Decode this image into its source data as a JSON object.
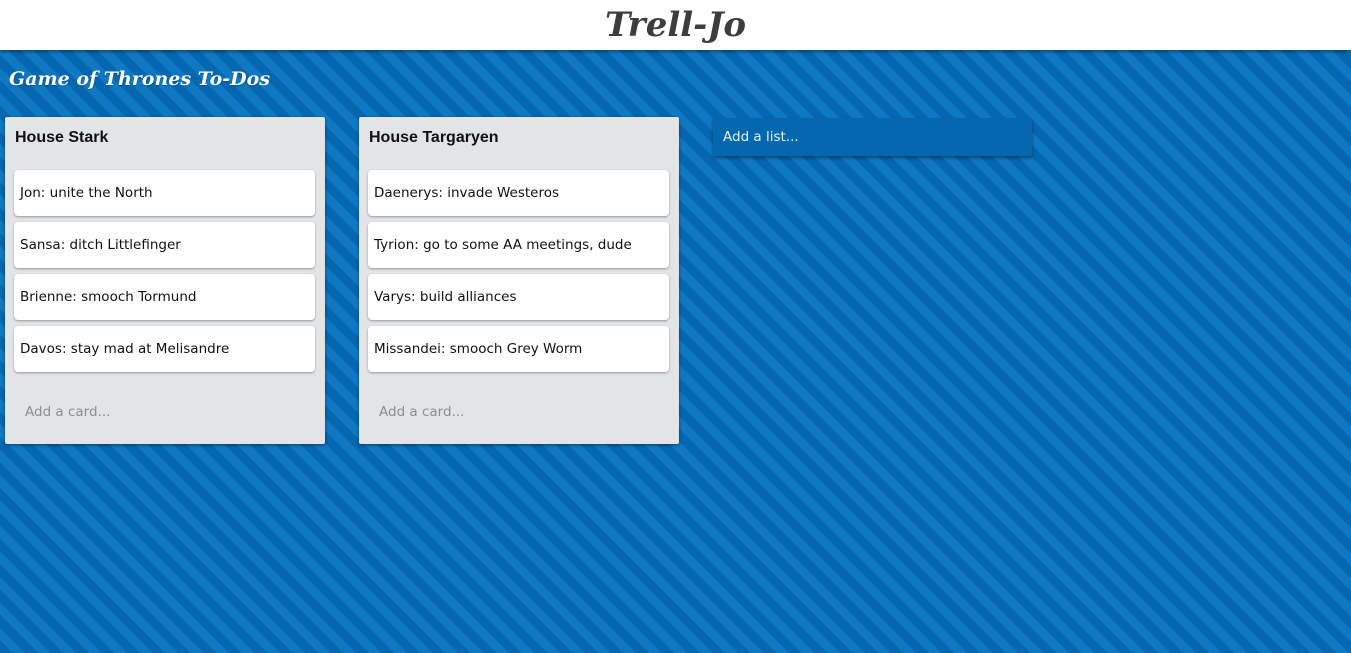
{
  "app": {
    "title": "Trell-Jo"
  },
  "board": {
    "title": "Game of Thrones To-Dos",
    "add_list_label": "Add a list..."
  },
  "lists": [
    {
      "title": "House Stark",
      "cards": [
        "Jon: unite the North",
        "Sansa: ditch Littlefinger",
        "Brienne: smooch Tormund",
        "Davos: stay mad at Melisandre"
      ],
      "add_card_label": "Add a card..."
    },
    {
      "title": "House Targaryen",
      "cards": [
        "Daenerys: invade Westeros",
        "Tyrion: go to some AA meetings, dude",
        "Varys: build alliances",
        "Missandei: smooch Grey Worm"
      ],
      "add_card_label": "Add a card..."
    }
  ],
  "colors": {
    "board_background": "#0a6db8",
    "stripe_dark": "#0467b0",
    "stripe_light": "#0f78c2",
    "list_background": "#e3e4e6",
    "add_list_background": "#0567ad",
    "header_background": "#ffffff"
  }
}
